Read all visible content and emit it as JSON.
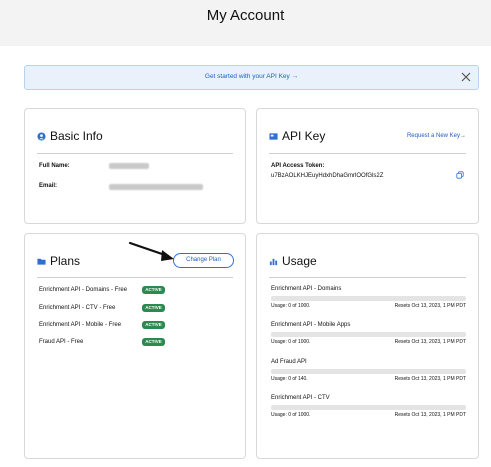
{
  "header": {
    "title": "My Account"
  },
  "banner": {
    "text": "Get started with your API Key →",
    "close_icon": "close-icon"
  },
  "basic_info": {
    "title": "Basic Info",
    "icon": "user-circle-icon",
    "fields": [
      {
        "label": "Full Name:",
        "value_redacted": true
      },
      {
        "label": "Email:",
        "value_redacted": true
      }
    ]
  },
  "api_key": {
    "title": "API Key",
    "icon": "key-card-icon",
    "request_link": "Request a New Key→",
    "token_label": "API Access Token:",
    "token_value": "u7BzAOLKHJEuyHdxhDhaGmrlOOfGls2Z",
    "copy_icon": "copy-icon"
  },
  "plans": {
    "title": "Plans",
    "icon": "folder-icon",
    "change_button": "Change Plan",
    "items": [
      {
        "name": "Enrichment API - Domains - Free",
        "status": "ACTIVE"
      },
      {
        "name": "Enrichment API - CTV - Free",
        "status": "ACTIVE"
      },
      {
        "name": "Enrichment API - Mobile - Free",
        "status": "ACTIVE"
      },
      {
        "name": "Fraud API - Free",
        "status": "ACTIVE"
      }
    ]
  },
  "usage": {
    "title": "Usage",
    "icon": "bar-chart-icon",
    "items": [
      {
        "name": "Enrichment API - Domains",
        "usage": "Usage: 0 of 1000.",
        "reset": "Resets Oct 13, 2023, 1 PM PDT",
        "fraction": 0
      },
      {
        "name": "Enrichment API - Mobile Apps",
        "usage": "Usage: 0 of 1000.",
        "reset": "Resets Oct 13, 2023, 1 PM PDT",
        "fraction": 0
      },
      {
        "name": "Ad Fraud API",
        "usage": "Usage: 0 of 140.",
        "reset": "Resets Oct 13, 2023, 1 PM PDT",
        "fraction": 0
      },
      {
        "name": "Enrichment API - CTV",
        "usage": "Usage: 0 of 1000.",
        "reset": "Resets Oct 13, 2023, 1 PM PDT",
        "fraction": 0
      }
    ]
  },
  "colors": {
    "accent": "#2e6fd1",
    "link": "#1f5fbf",
    "active_badge": "#2a8a4f",
    "banner_bg": "#e9f2fb"
  }
}
